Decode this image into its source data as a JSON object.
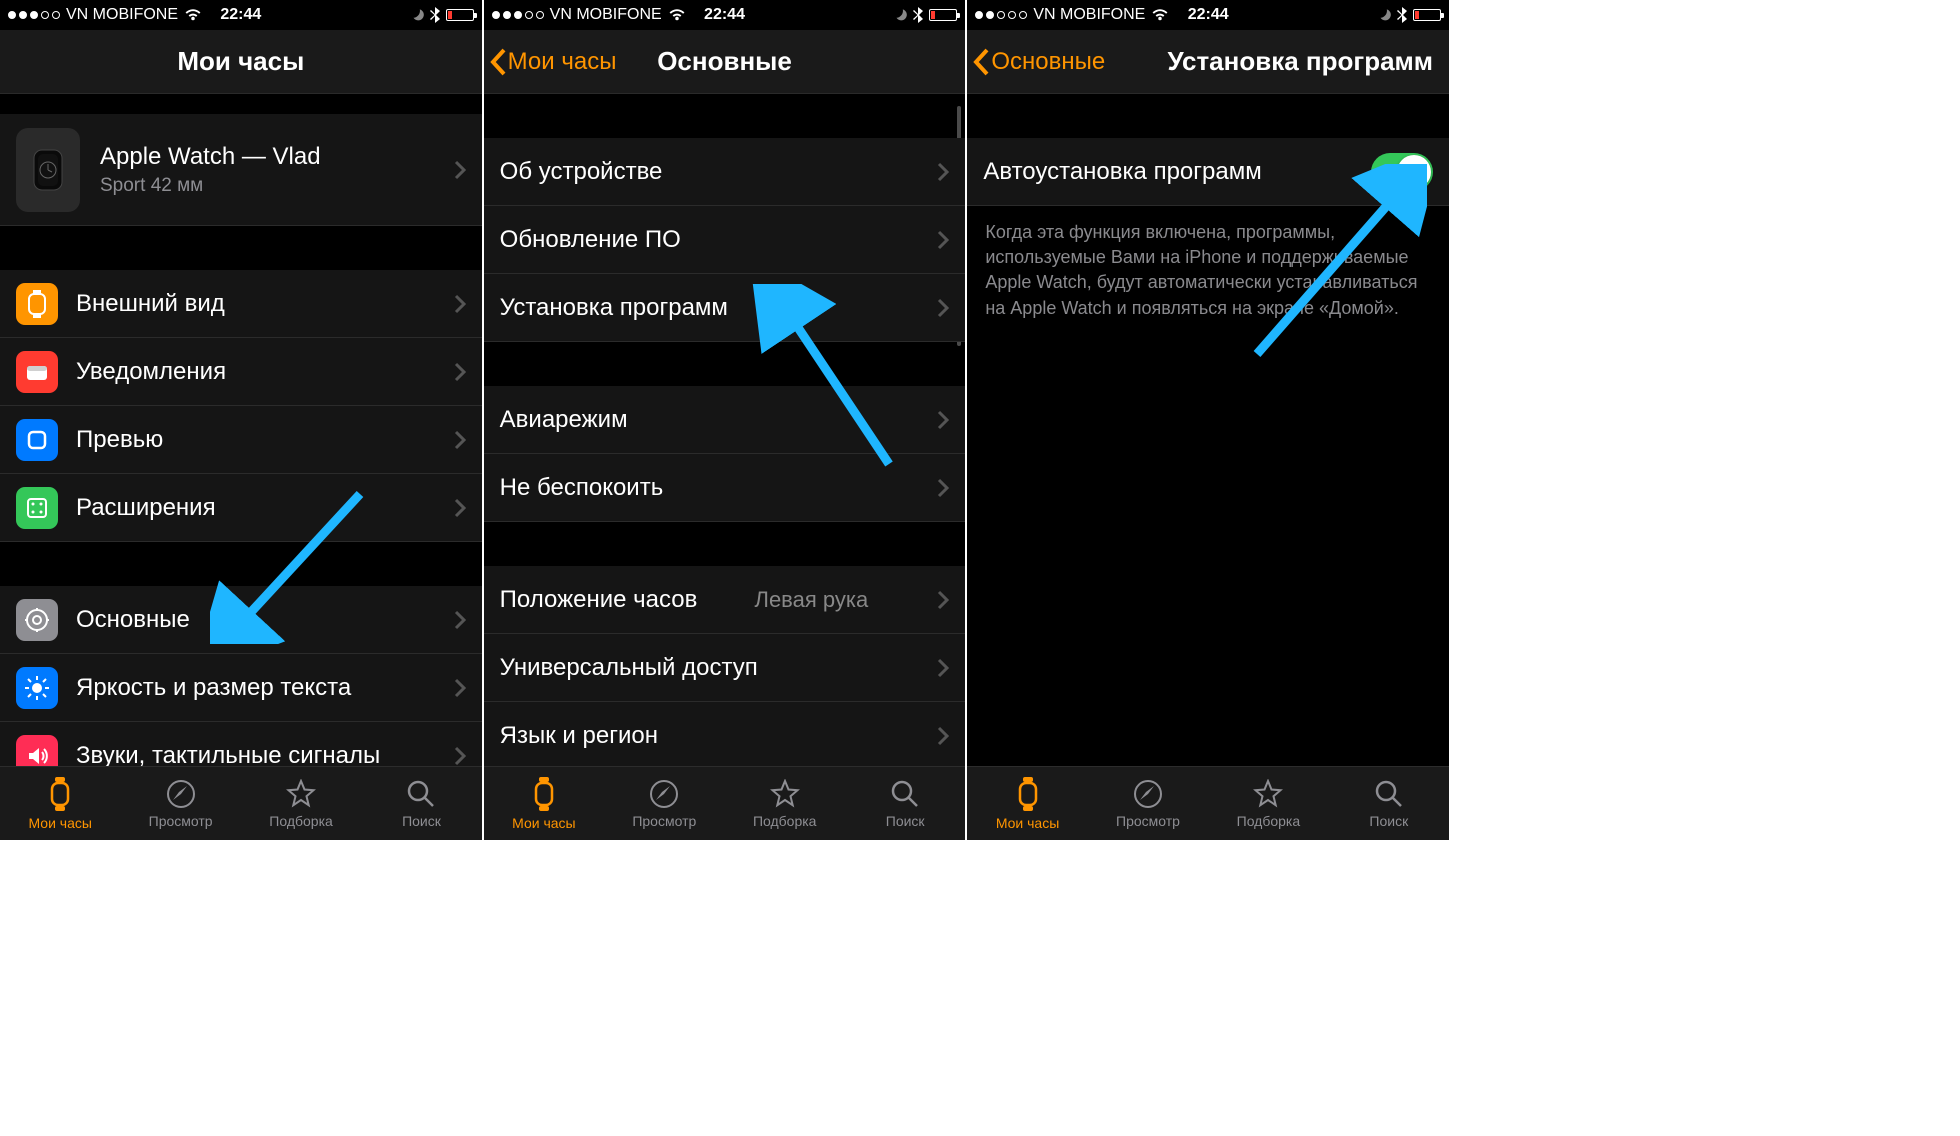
{
  "status": {
    "carrier": "VN MOBIFONE",
    "time": "22:44",
    "signal_filled": 3,
    "signal_total": 5,
    "battery_pct": 12
  },
  "screen1": {
    "nav_title": "Мои часы",
    "device": {
      "title": "Apple Watch — Vlad",
      "subtitle": "Sport 42 мм"
    },
    "rows_g1": [
      {
        "label": "Внешний вид",
        "icon_name": "appearance-icon",
        "color": "#ff9500"
      },
      {
        "label": "Уведомления",
        "icon_name": "notifications-icon",
        "color": "#ff3b30"
      },
      {
        "label": "Превью",
        "icon_name": "preview-icon",
        "color": "#007aff"
      },
      {
        "label": "Расширения",
        "icon_name": "extensions-icon",
        "color": "#34c759"
      }
    ],
    "rows_g2": [
      {
        "label": "Основные",
        "icon_name": "general-icon",
        "color": "#8e8e93"
      },
      {
        "label": "Яркость и размер текста",
        "icon_name": "brightness-icon",
        "color": "#007aff"
      },
      {
        "label": "Звуки, тактильные сигналы",
        "icon_name": "sounds-icon",
        "color": "#ff2d55"
      }
    ]
  },
  "screen2": {
    "nav_back": "Мои часы",
    "nav_title": "Основные",
    "rows_g1": [
      {
        "label": "Об устройстве"
      },
      {
        "label": "Обновление ПО"
      },
      {
        "label": "Установка программ"
      }
    ],
    "rows_g2": [
      {
        "label": "Авиарежим"
      },
      {
        "label": "Не беспокоить"
      }
    ],
    "rows_g3": [
      {
        "label": "Положение часов",
        "detail": "Левая рука"
      },
      {
        "label": "Универсальный доступ"
      },
      {
        "label": "Язык и регион"
      }
    ]
  },
  "screen3": {
    "nav_back": "Основные",
    "nav_title": "Установка программ",
    "toggle_label": "Автоустановка программ",
    "toggle_on": true,
    "note": "Когда эта функция включена, программы, используемые Вами на iPhone и поддерживаемые Apple Watch, будут автоматически устанавливаться на Apple Watch и появляться на экране «Домой»."
  },
  "tabs": [
    {
      "name": "my-watch",
      "label": "Мои часы",
      "icon": "watch"
    },
    {
      "name": "browse",
      "label": "Просмотр",
      "icon": "compass"
    },
    {
      "name": "featured",
      "label": "Подборка",
      "icon": "star"
    },
    {
      "name": "search",
      "label": "Поиск",
      "icon": "search"
    }
  ],
  "colors": {
    "accent": "#ff9500",
    "toggle_on": "#34c759",
    "arrow": "#1fb6ff"
  }
}
